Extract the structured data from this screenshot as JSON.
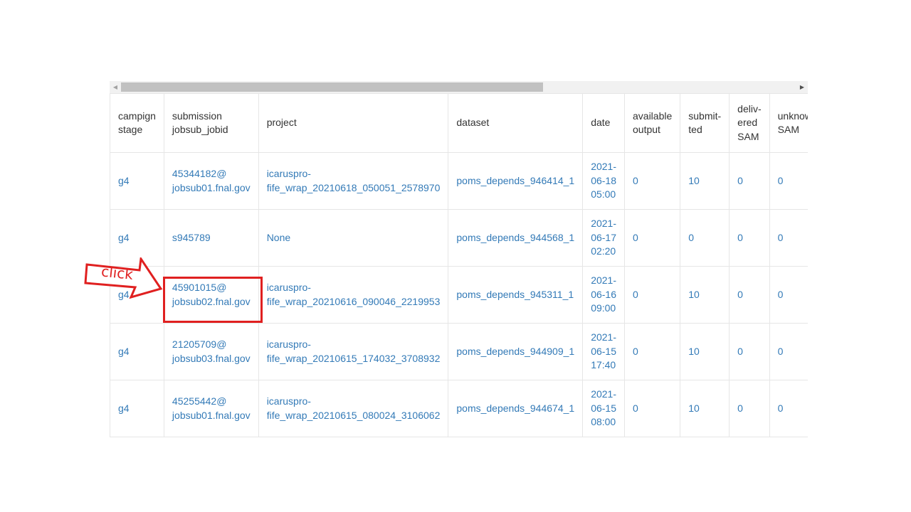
{
  "columns": [
    {
      "line1": "campign",
      "line2": "stage",
      "line3": ""
    },
    {
      "line1": "submission",
      "line2": "jobsub_jobid",
      "line3": ""
    },
    {
      "line1": "project",
      "line2": "",
      "line3": ""
    },
    {
      "line1": "dataset",
      "line2": "",
      "line3": ""
    },
    {
      "line1": "date",
      "line2": "",
      "line3": ""
    },
    {
      "line1": "available",
      "line2": "output",
      "line3": ""
    },
    {
      "line1": "submit-",
      "line2": "ted",
      "line3": ""
    },
    {
      "line1": "deliv-",
      "line2": "ered",
      "line3": "SAM"
    },
    {
      "line1": "unknow",
      "line2": "SAM",
      "line3": ""
    }
  ],
  "rows": [
    {
      "stage": "g4",
      "jobid": [
        "45344182@",
        "jobsub01.fnal.gov"
      ],
      "project": [
        "icaruspro-",
        "fife_wrap_20210618_050051_2578970"
      ],
      "dataset": "poms_depends_946414_1",
      "date": [
        "2021-",
        "06-18",
        "05:00"
      ],
      "available_output": "0",
      "submitted": "10",
      "delivered_sam": "0",
      "unknown_sam": "0"
    },
    {
      "stage": "g4",
      "jobid": [
        "s945789",
        ""
      ],
      "project": [
        "None",
        ""
      ],
      "dataset": "poms_depends_944568_1",
      "date": [
        "2021-",
        "06-17",
        "02:20"
      ],
      "available_output": "0",
      "submitted": "0",
      "delivered_sam": "0",
      "unknown_sam": "0"
    },
    {
      "stage": "g4",
      "jobid": [
        "45901015@",
        "jobsub02.fnal.gov"
      ],
      "project": [
        "icaruspro-",
        "fife_wrap_20210616_090046_2219953"
      ],
      "dataset": "poms_depends_945311_1",
      "date": [
        "2021-",
        "06-16",
        "09:00"
      ],
      "available_output": "0",
      "submitted": "10",
      "delivered_sam": "0",
      "unknown_sam": "0"
    },
    {
      "stage": "g4",
      "jobid": [
        "21205709@",
        "jobsub03.fnal.gov"
      ],
      "project": [
        "icaruspro-",
        "fife_wrap_20210615_174032_3708932"
      ],
      "dataset": "poms_depends_944909_1",
      "date": [
        "2021-",
        "06-15",
        "17:40"
      ],
      "available_output": "0",
      "submitted": "10",
      "delivered_sam": "0",
      "unknown_sam": "0"
    },
    {
      "stage": "g4",
      "jobid": [
        "45255442@",
        "jobsub01.fnal.gov"
      ],
      "project": [
        "icaruspro-",
        "fife_wrap_20210615_080024_3106062"
      ],
      "dataset": "poms_depends_944674_1",
      "date": [
        "2021-",
        "06-15",
        "08:00"
      ],
      "available_output": "0",
      "submitted": "10",
      "delivered_sam": "0",
      "unknown_sam": "0"
    }
  ],
  "annotation": {
    "label": "click",
    "color": "#e02020"
  },
  "scrollbar": {
    "left_arrow": "◀",
    "right_arrow": "▶"
  },
  "colors": {
    "link": "#337ab7",
    "header_text": "#333333",
    "border": "#e6e6e6"
  }
}
